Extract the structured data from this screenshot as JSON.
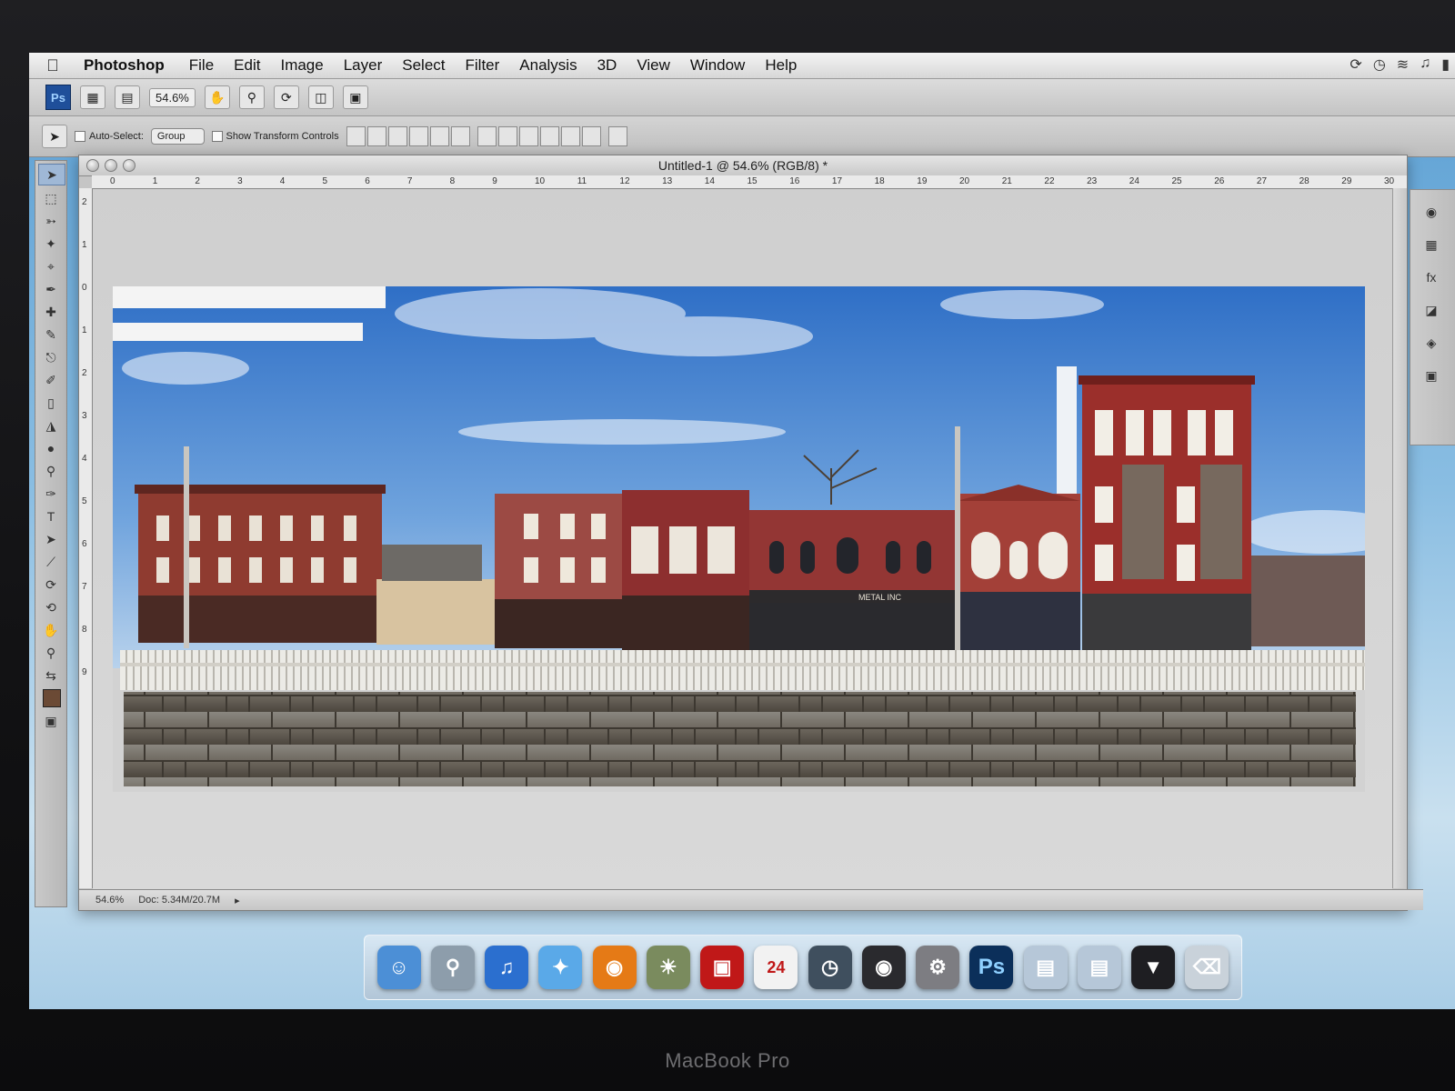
{
  "bezel": {
    "label": "MacBook Pro"
  },
  "menubar": {
    "app": "Photoshop",
    "items": [
      "File",
      "Edit",
      "Image",
      "Layer",
      "Select",
      "Filter",
      "Analysis",
      "3D",
      "View",
      "Window",
      "Help"
    ]
  },
  "appbar": {
    "ps_logo": "Ps",
    "zoom": "54.6%"
  },
  "options": {
    "auto_select_label": "Auto-Select:",
    "group_value": "Group",
    "transform_label": "Show Transform Controls"
  },
  "document": {
    "title": "Untitled-1 @ 54.6% (RGB/8) *",
    "ruler_h": [
      "0",
      "1",
      "2",
      "3",
      "4",
      "5",
      "6",
      "7",
      "8",
      "9",
      "10",
      "11",
      "12",
      "13",
      "14",
      "15",
      "16",
      "17",
      "18",
      "19",
      "20",
      "21",
      "22",
      "23",
      "24",
      "25",
      "26",
      "27",
      "28",
      "29",
      "30"
    ],
    "ruler_v": [
      "2",
      "1",
      "0",
      "1",
      "2",
      "3",
      "4",
      "5",
      "6",
      "7",
      "8",
      "9"
    ],
    "status_zoom": "54.6%",
    "status_doc": "Doc: 5.34M/20.7M",
    "sign_text": "METAL INC"
  },
  "dock": {
    "calendar_day": "24",
    "ps_label": "Ps",
    "icons": [
      "finder-icon",
      "preview-icon",
      "itunes-icon",
      "safari-icon",
      "firefox-icon",
      "iphoto-icon",
      "photo-booth-icon",
      "ical-icon",
      "time-machine-icon",
      "dashboard-icon",
      "system-preferences-icon",
      "photoshop-icon",
      "applications-folder-icon",
      "documents-folder-icon",
      "downloads-stack-icon",
      "trash-icon"
    ]
  },
  "colors": {
    "foreground_swatch": "#6b4a35",
    "brick_red": "#8f2e2a",
    "sky_blue": "#3f7fd0"
  }
}
